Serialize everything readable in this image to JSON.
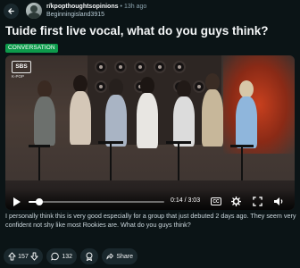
{
  "header": {
    "subreddit": "r/kpopthoughtsopinions",
    "time": "13h ago",
    "username": "Beginningisland3915"
  },
  "post": {
    "title": "Tuide first live vocal, what do you guys think?",
    "flair": "CONVERSATION",
    "flair_color": "#0d9a4b",
    "body": "I personally think this is very good especially for a group that just debuted 2 days ago. They seem very confident not shy like most Rookies are. What do you guys think?"
  },
  "video": {
    "watermark": "SBS",
    "watermark_sub": "K-POP",
    "time_current": "0:14",
    "time_total": "3:03",
    "time_display": "0:14 / 3:03",
    "progress": 0.076,
    "cc_label": "CC"
  },
  "actions": {
    "upvotes": "157",
    "comments": "132",
    "share_label": "Share"
  },
  "icons": {
    "back": "back-arrow-icon",
    "upvote": "upvote-icon",
    "downvote": "downvote-icon",
    "comment": "comment-icon",
    "award": "award-icon",
    "share": "share-icon",
    "play": "play-icon",
    "settings": "settings-icon",
    "fullscreen": "fullscreen-icon"
  }
}
